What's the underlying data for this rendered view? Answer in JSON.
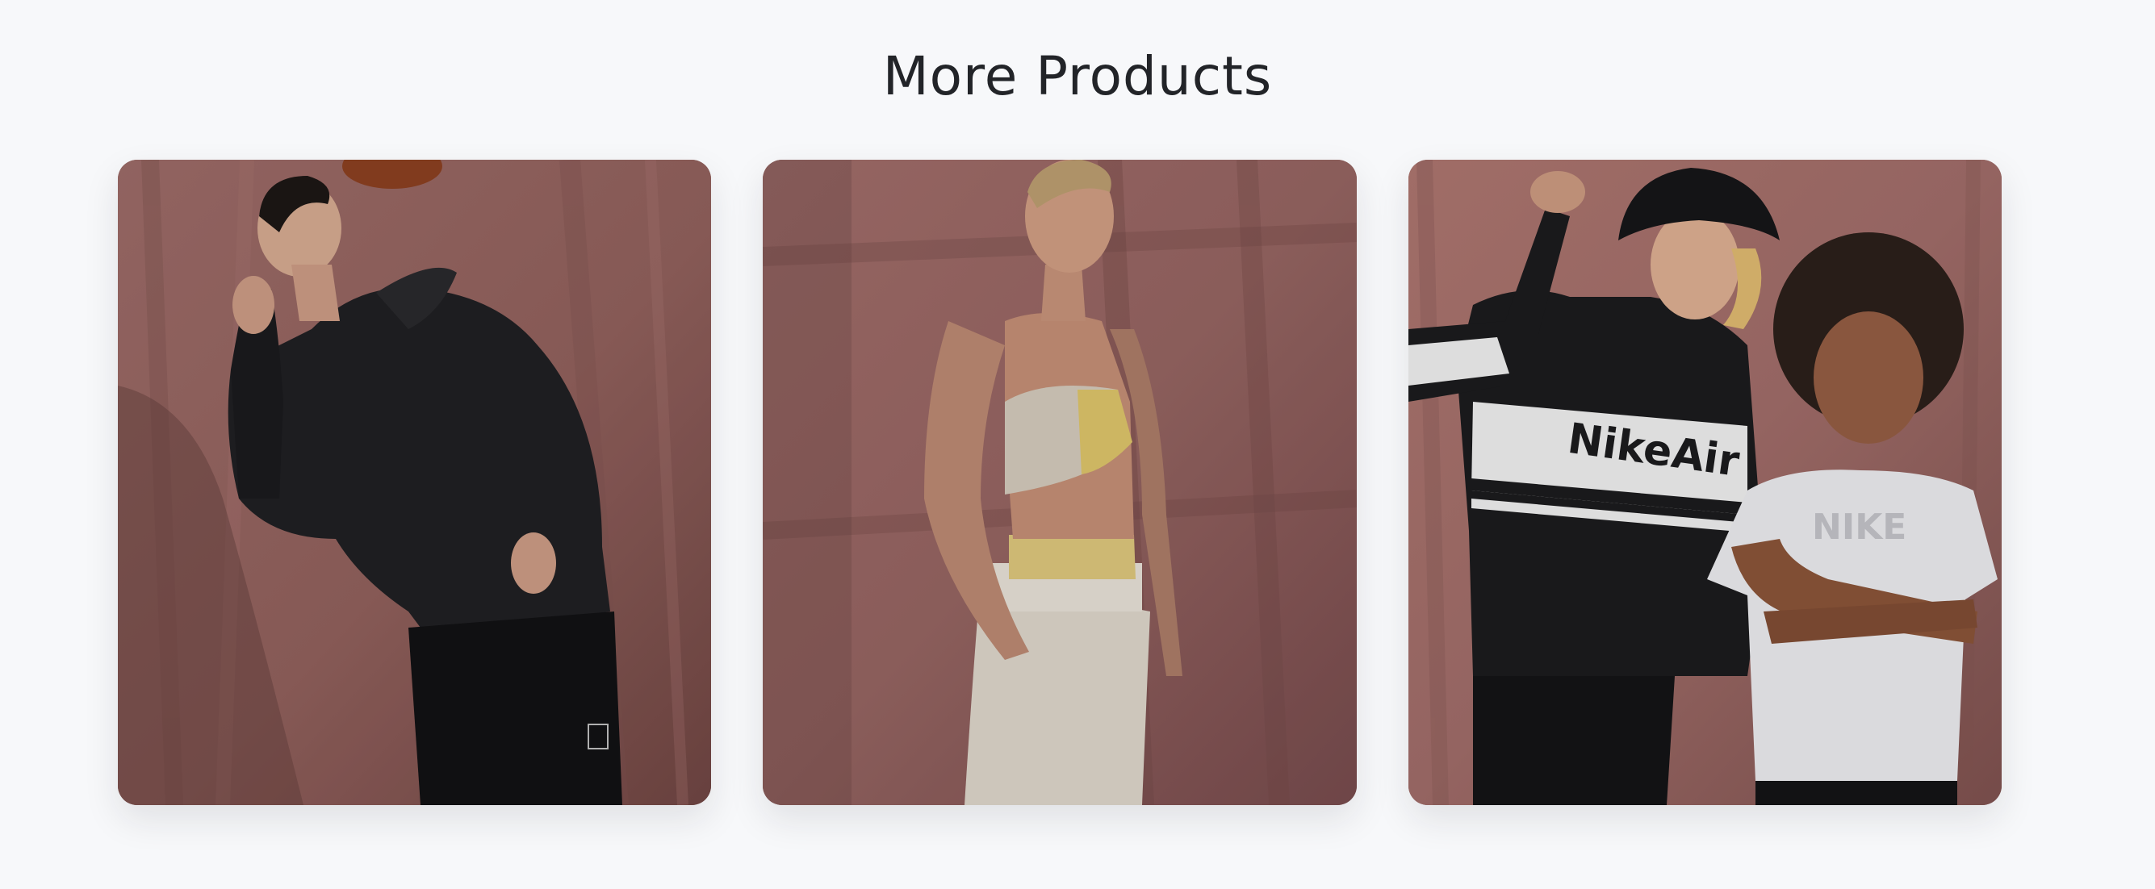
{
  "section": {
    "title": "More Products"
  },
  "products": [
    {
      "name": "product-card-1",
      "image_alt": "Man in black hoodie and shorts looking up at basketball",
      "icon": "product-photo"
    },
    {
      "name": "product-card-2",
      "image_alt": "Woman in yellow sports bra and white joggers",
      "icon": "product-photo"
    },
    {
      "name": "product-card-3",
      "image_alt": "Two kids in black Nike Air half-zip and white Nike tee",
      "icon": "product-photo",
      "printed_text": [
        "NikeAir",
        "NIKE"
      ]
    }
  ],
  "colors": {
    "background": "#f7f8fa",
    "title": "#222428",
    "backdrop": "#8d5f5c"
  }
}
